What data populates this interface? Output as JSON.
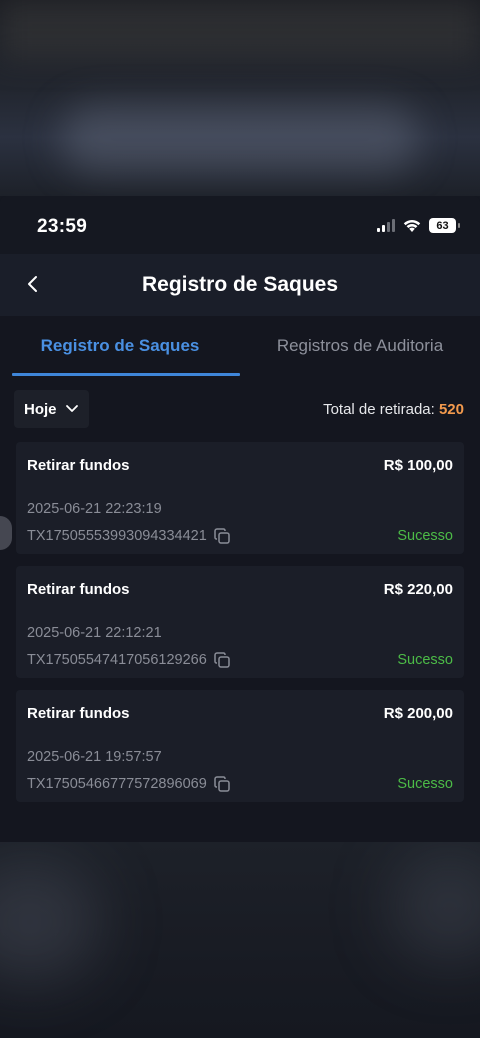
{
  "status_bar": {
    "time": "23:59",
    "battery": "63"
  },
  "header": {
    "title": "Registro de Saques"
  },
  "tabs": [
    {
      "label": "Registro de Saques",
      "active": true
    },
    {
      "label": "Registros de Auditoria",
      "active": false
    }
  ],
  "filter": {
    "date_value": "Hoje",
    "total_label": "Total de retirada:",
    "total_value": "520"
  },
  "records": [
    {
      "title": "Retirar fundos",
      "amount": "R$ 100,00",
      "datetime": "2025-06-21 22:23:19",
      "tx_id": "TX17505553993094334421",
      "status": "Sucesso"
    },
    {
      "title": "Retirar fundos",
      "amount": "R$ 220,00",
      "datetime": "2025-06-21 22:12:21",
      "tx_id": "TX17505547417056129266",
      "status": "Sucesso"
    },
    {
      "title": "Retirar fundos",
      "amount": "R$ 200,00",
      "datetime": "2025-06-21 19:57:57",
      "tx_id": "TX17505466777572896069",
      "status": "Sucesso"
    }
  ],
  "colors": {
    "accent": "#4a90e2",
    "total_value": "#f39a4d",
    "success": "#4cbb47",
    "background": "#14161f",
    "card": "#1b1e28"
  },
  "icons": {
    "back": "chevron-left-icon",
    "dropdown": "chevron-down-icon",
    "copy": "copy-icon",
    "wifi": "wifi-icon",
    "signal": "signal-icon",
    "battery": "battery-icon"
  }
}
